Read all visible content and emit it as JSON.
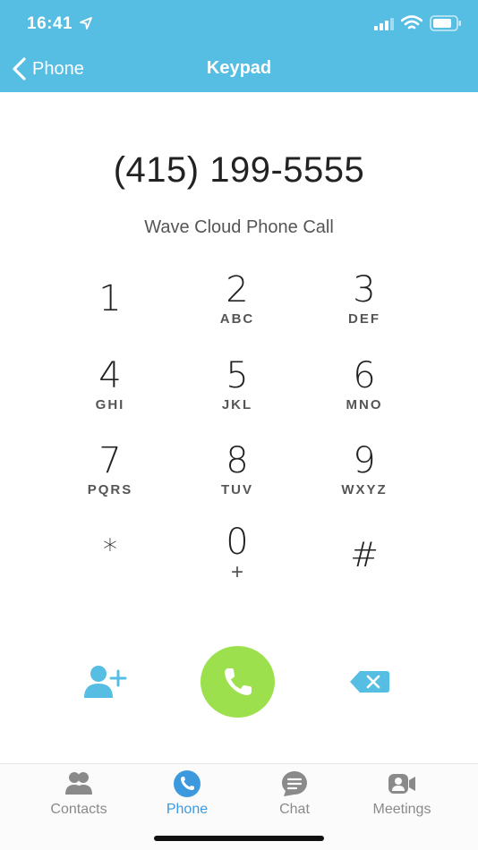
{
  "status_bar": {
    "time": "16:41"
  },
  "nav": {
    "back_label": "Phone",
    "title": "Keypad"
  },
  "dialer": {
    "number": "(415) 199-5555",
    "call_type": "Wave Cloud Phone Call"
  },
  "keypad": {
    "keys": [
      {
        "digit": "1",
        "letters": ""
      },
      {
        "digit": "2",
        "letters": "ABC"
      },
      {
        "digit": "3",
        "letters": "DEF"
      },
      {
        "digit": "4",
        "letters": "GHI"
      },
      {
        "digit": "5",
        "letters": "JKL"
      },
      {
        "digit": "6",
        "letters": "MNO"
      },
      {
        "digit": "7",
        "letters": "PQRS"
      },
      {
        "digit": "8",
        "letters": "TUV"
      },
      {
        "digit": "9",
        "letters": "WXYZ"
      },
      {
        "digit": "*",
        "letters": ""
      },
      {
        "digit": "0",
        "letters": "+"
      },
      {
        "digit": "#",
        "letters": ""
      }
    ]
  },
  "tabs": [
    {
      "label": "Contacts",
      "icon": "contacts-icon",
      "active": false
    },
    {
      "label": "Phone",
      "icon": "phone-icon",
      "active": true
    },
    {
      "label": "Chat",
      "icon": "chat-icon",
      "active": false
    },
    {
      "label": "Meetings",
      "icon": "meetings-icon",
      "active": false
    }
  ],
  "colors": {
    "header": "#56bde3",
    "call_button": "#9ce14d",
    "accent": "#3d99de",
    "action_icon": "#56bde3"
  }
}
